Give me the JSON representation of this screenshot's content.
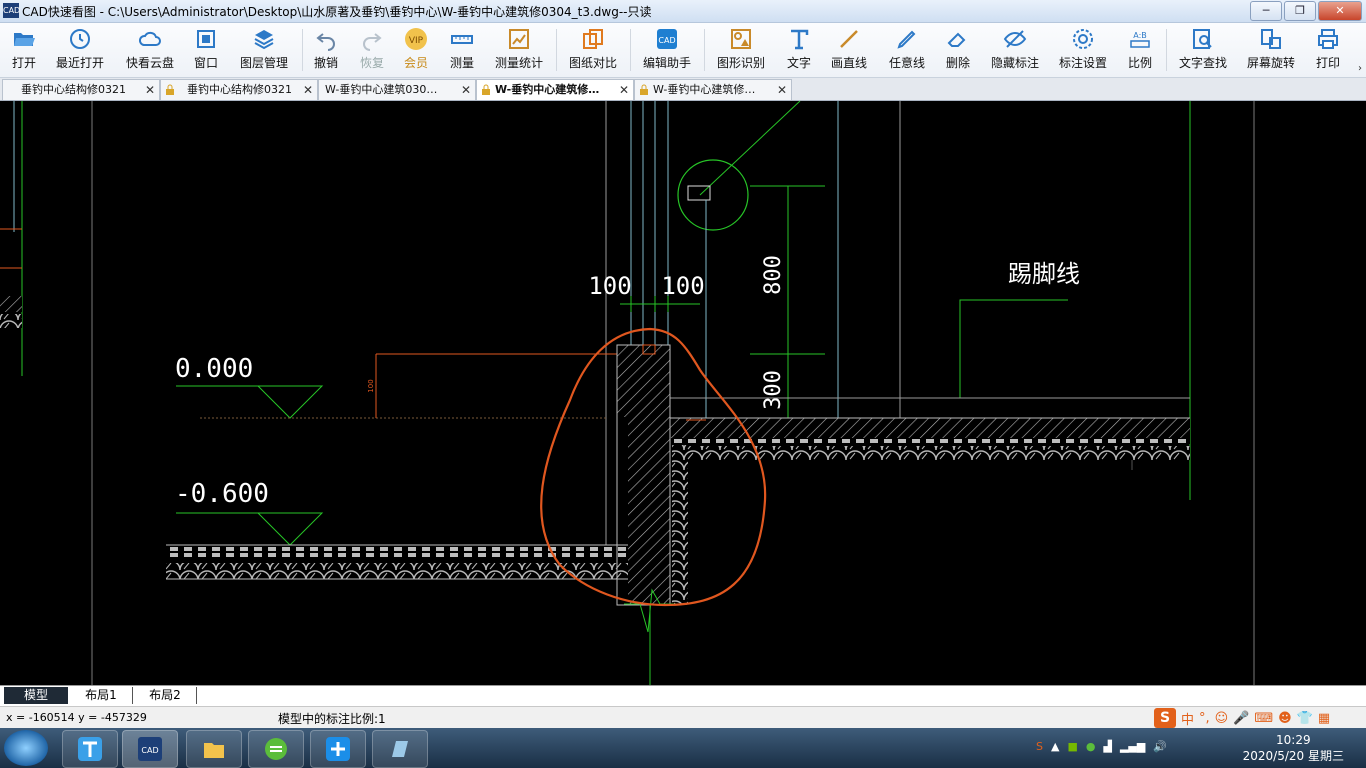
{
  "window": {
    "title": "CAD快速看图 - C:\\Users\\Administrator\\Desktop\\山水原著及垂钓\\垂钓中心\\W-垂钓中心建筑修0304_t3.dwg--只读",
    "app_icon": "CAD"
  },
  "toolbar": {
    "items": [
      "打开",
      "最近打开",
      "快看云盘",
      "窗口",
      "图层管理",
      "撤销",
      "恢复",
      "会员",
      "测量",
      "测量统计",
      "图纸对比",
      "编辑助手",
      "图形识别",
      "文字",
      "画直线",
      "任意线",
      "删除",
      "隐藏标注",
      "标注设置",
      "比例",
      "文字查找",
      "屏幕旋转",
      "打印"
    ]
  },
  "tabs": [
    {
      "label": "垂钓中心结构修0321",
      "locked": false
    },
    {
      "label": "垂钓中心结构修0321",
      "locked": true
    },
    {
      "label": "W-垂钓中心建筑030…",
      "locked": false
    },
    {
      "label": "W-垂钓中心建筑修…",
      "locked": true,
      "active": true
    },
    {
      "label": "W-垂钓中心建筑修…",
      "locked": true
    }
  ],
  "drawing": {
    "elev_top": "0.000",
    "elev_bottom": "-0.600",
    "dim_left": "100",
    "dim_right": "100",
    "dim_800": "800",
    "dim_300": "300",
    "small_dim": "100",
    "label_baseboard": "踢脚线"
  },
  "layout_tabs": [
    "模型",
    "布局1",
    "布局2"
  ],
  "status": {
    "coords": "x = -160514  y = -457329",
    "scale": "模型中的标注比例:1"
  },
  "ime": {
    "lang": "中",
    "punct": "°,"
  },
  "clock": {
    "time": "10:29",
    "date": "2020/5/20 星期三"
  },
  "colors": {
    "green": "#27c427",
    "hatch": "#9a9a9a",
    "orange": "#e0571f",
    "cyan": "#7fb7c9"
  }
}
